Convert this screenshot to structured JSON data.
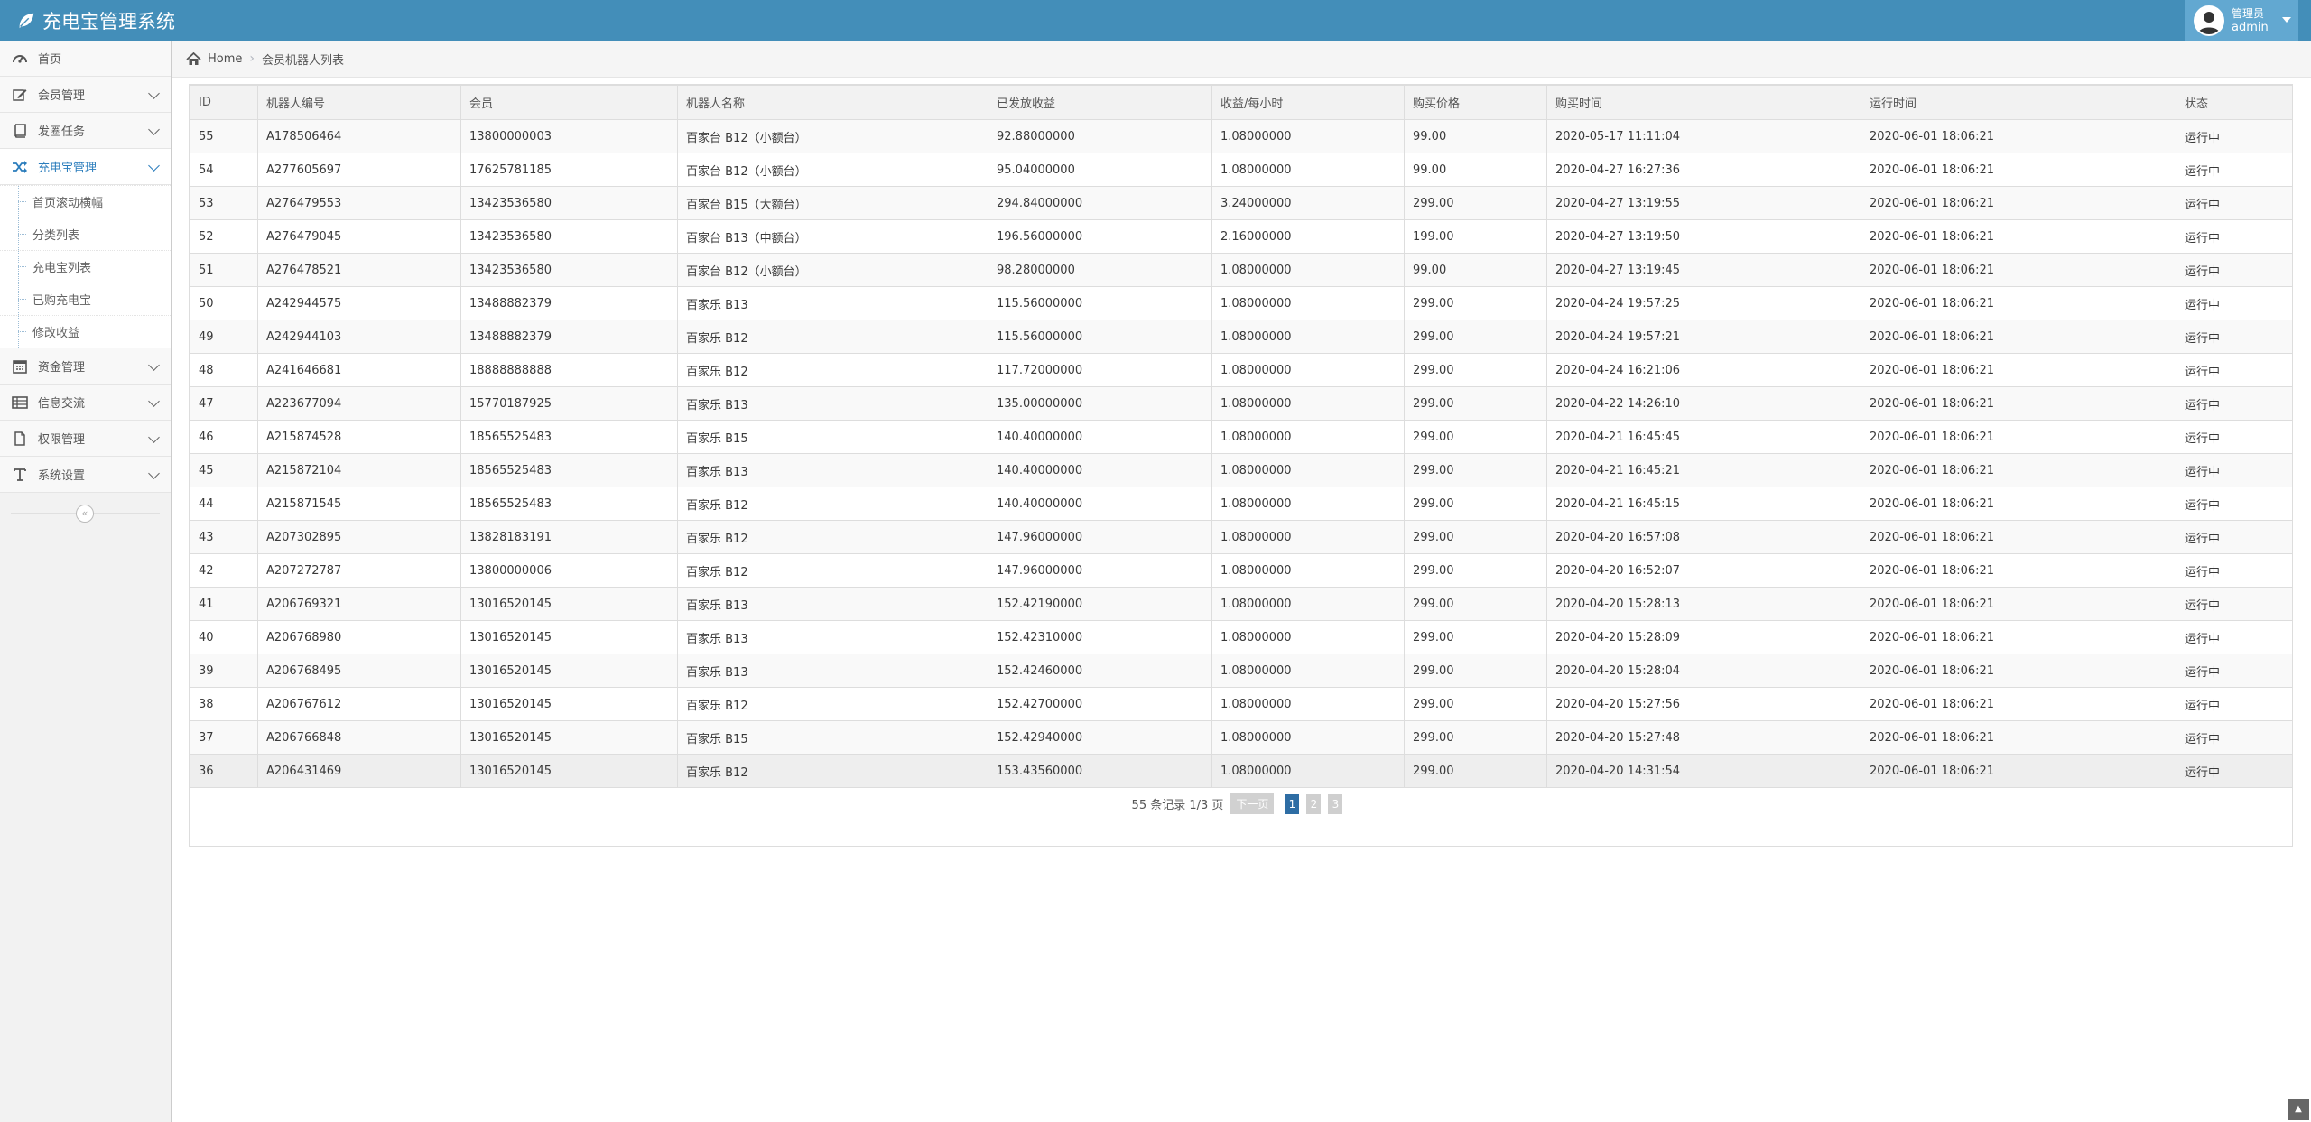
{
  "app": {
    "title": "充电宝管理系统"
  },
  "user": {
    "role": "管理员",
    "name": "admin"
  },
  "sidebar": {
    "items": [
      {
        "label": "首页",
        "icon": "dashboard-icon"
      },
      {
        "label": "会员管理",
        "icon": "edit-icon"
      },
      {
        "label": "发圈任务",
        "icon": "book-icon"
      },
      {
        "label": "充电宝管理",
        "icon": "shuffle-icon",
        "active": true,
        "children": [
          "首页滚动横幅",
          "分类列表",
          "充电宝列表",
          "已购充电宝",
          "修改收益"
        ]
      },
      {
        "label": "资金管理",
        "icon": "calendar-icon"
      },
      {
        "label": "信息交流",
        "icon": "list-icon"
      },
      {
        "label": "权限管理",
        "icon": "file-icon"
      },
      {
        "label": "系统设置",
        "icon": "text-icon"
      }
    ],
    "collapse_symbol": "«"
  },
  "breadcrumb": {
    "home": "Home",
    "current": "会员机器人列表"
  },
  "table": {
    "headers": [
      "ID",
      "机器人编号",
      "会员",
      "机器人名称",
      "已发放收益",
      "收益/每小时",
      "购买价格",
      "购买时间",
      "运行时间",
      "状态"
    ],
    "rows": [
      [
        "55",
        "A178506464",
        "13800000003",
        "百家台 B12（小额台）",
        "92.88000000",
        "1.08000000",
        "99.00",
        "2020-05-17 11:11:04",
        "2020-06-01 18:06:21",
        "运行中"
      ],
      [
        "54",
        "A277605697",
        "17625781185",
        "百家台 B12（小额台）",
        "95.04000000",
        "1.08000000",
        "99.00",
        "2020-04-27 16:27:36",
        "2020-06-01 18:06:21",
        "运行中"
      ],
      [
        "53",
        "A276479553",
        "13423536580",
        "百家台 B15（大额台）",
        "294.84000000",
        "3.24000000",
        "299.00",
        "2020-04-27 13:19:55",
        "2020-06-01 18:06:21",
        "运行中"
      ],
      [
        "52",
        "A276479045",
        "13423536580",
        "百家台 B13（中额台）",
        "196.56000000",
        "2.16000000",
        "199.00",
        "2020-04-27 13:19:50",
        "2020-06-01 18:06:21",
        "运行中"
      ],
      [
        "51",
        "A276478521",
        "13423536580",
        "百家台 B12（小额台）",
        "98.28000000",
        "1.08000000",
        "99.00",
        "2020-04-27 13:19:45",
        "2020-06-01 18:06:21",
        "运行中"
      ],
      [
        "50",
        "A242944575",
        "13488882379",
        "百家乐 B13",
        "115.56000000",
        "1.08000000",
        "299.00",
        "2020-04-24 19:57:25",
        "2020-06-01 18:06:21",
        "运行中"
      ],
      [
        "49",
        "A242944103",
        "13488882379",
        "百家乐 B12",
        "115.56000000",
        "1.08000000",
        "299.00",
        "2020-04-24 19:57:21",
        "2020-06-01 18:06:21",
        "运行中"
      ],
      [
        "48",
        "A241646681",
        "18888888888",
        "百家乐 B12",
        "117.72000000",
        "1.08000000",
        "299.00",
        "2020-04-24 16:21:06",
        "2020-06-01 18:06:21",
        "运行中"
      ],
      [
        "47",
        "A223677094",
        "15770187925",
        "百家乐 B13",
        "135.00000000",
        "1.08000000",
        "299.00",
        "2020-04-22 14:26:10",
        "2020-06-01 18:06:21",
        "运行中"
      ],
      [
        "46",
        "A215874528",
        "18565525483",
        "百家乐 B15",
        "140.40000000",
        "1.08000000",
        "299.00",
        "2020-04-21 16:45:45",
        "2020-06-01 18:06:21",
        "运行中"
      ],
      [
        "45",
        "A215872104",
        "18565525483",
        "百家乐 B13",
        "140.40000000",
        "1.08000000",
        "299.00",
        "2020-04-21 16:45:21",
        "2020-06-01 18:06:21",
        "运行中"
      ],
      [
        "44",
        "A215871545",
        "18565525483",
        "百家乐 B12",
        "140.40000000",
        "1.08000000",
        "299.00",
        "2020-04-21 16:45:15",
        "2020-06-01 18:06:21",
        "运行中"
      ],
      [
        "43",
        "A207302895",
        "13828183191",
        "百家乐 B12",
        "147.96000000",
        "1.08000000",
        "299.00",
        "2020-04-20 16:57:08",
        "2020-06-01 18:06:21",
        "运行中"
      ],
      [
        "42",
        "A207272787",
        "13800000006",
        "百家乐 B12",
        "147.96000000",
        "1.08000000",
        "299.00",
        "2020-04-20 16:52:07",
        "2020-06-01 18:06:21",
        "运行中"
      ],
      [
        "41",
        "A206769321",
        "13016520145",
        "百家乐 B13",
        "152.42190000",
        "1.08000000",
        "299.00",
        "2020-04-20 15:28:13",
        "2020-06-01 18:06:21",
        "运行中"
      ],
      [
        "40",
        "A206768980",
        "13016520145",
        "百家乐 B13",
        "152.42310000",
        "1.08000000",
        "299.00",
        "2020-04-20 15:28:09",
        "2020-06-01 18:06:21",
        "运行中"
      ],
      [
        "39",
        "A206768495",
        "13016520145",
        "百家乐 B13",
        "152.42460000",
        "1.08000000",
        "299.00",
        "2020-04-20 15:28:04",
        "2020-06-01 18:06:21",
        "运行中"
      ],
      [
        "38",
        "A206767612",
        "13016520145",
        "百家乐 B12",
        "152.42700000",
        "1.08000000",
        "299.00",
        "2020-04-20 15:27:56",
        "2020-06-01 18:06:21",
        "运行中"
      ],
      [
        "37",
        "A206766848",
        "13016520145",
        "百家乐 B15",
        "152.42940000",
        "1.08000000",
        "299.00",
        "2020-04-20 15:27:48",
        "2020-06-01 18:06:21",
        "运行中"
      ],
      [
        "36",
        "A206431469",
        "13016520145",
        "百家乐 B12",
        "153.43560000",
        "1.08000000",
        "299.00",
        "2020-04-20 14:31:54",
        "2020-06-01 18:06:21",
        "运行中"
      ]
    ]
  },
  "pagination": {
    "info": "55 条记录 1/3 页",
    "prev_label": "下一页",
    "pages": [
      "1",
      "2",
      "3"
    ],
    "current": "1"
  },
  "colors": {
    "navbar": "#438eb9",
    "accent": "#2b7dbc",
    "active_page": "#2e6da4"
  },
  "scroll_top_icon": "double-chevron-up-icon"
}
